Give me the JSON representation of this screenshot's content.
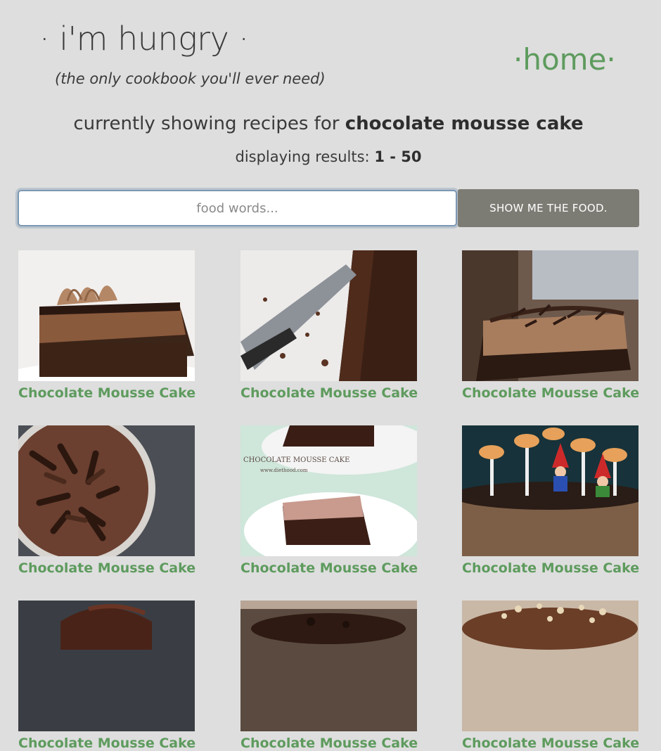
{
  "header": {
    "title": "· i'm hungry ·",
    "tagline": "(the only cookbook you'll ever need)",
    "home_link": "·home·"
  },
  "status": {
    "showing_prefix": "currently showing recipes for",
    "query": "chocolate mousse cake",
    "results_prefix": "displaying results:",
    "results_range": "1 - 50"
  },
  "search": {
    "placeholder": "food words...",
    "value": "",
    "button_label": "SHOW ME THE FOOD."
  },
  "colors": {
    "background": "#dedede",
    "link_green": "#5e9b5e",
    "button_gray": "#7d7c74"
  },
  "recipes": [
    {
      "title": "Chocolate Mousse Cake",
      "image_icon": "cake-slice-piped-cream-image"
    },
    {
      "title": "Chocolate Mousse Cake",
      "image_icon": "cake-with-server-image"
    },
    {
      "title": "Chocolate Mousse Cake",
      "image_icon": "cake-slice-chocolate-curls-image"
    },
    {
      "title": "Chocolate Mousse Cake",
      "image_icon": "cake-top-chocolate-curls-image"
    },
    {
      "title": "Chocolate Mousse Cake",
      "image_icon": "cake-slice-on-plate-image"
    },
    {
      "title": "Chocolate Mousse Cake",
      "image_icon": "cake-mushroom-gnome-image"
    },
    {
      "title": "Chocolate Mousse Cake",
      "image_icon": "cake-image"
    },
    {
      "title": "Chocolate Mousse Cake",
      "image_icon": "cake-image"
    },
    {
      "title": "Chocolate Mousse Cake",
      "image_icon": "cake-nuts-topping-image"
    }
  ],
  "image_overlays": {
    "plate_caption": "CHOCOLATE MOUSSE CAKE",
    "plate_url": "www.diethood.com"
  }
}
